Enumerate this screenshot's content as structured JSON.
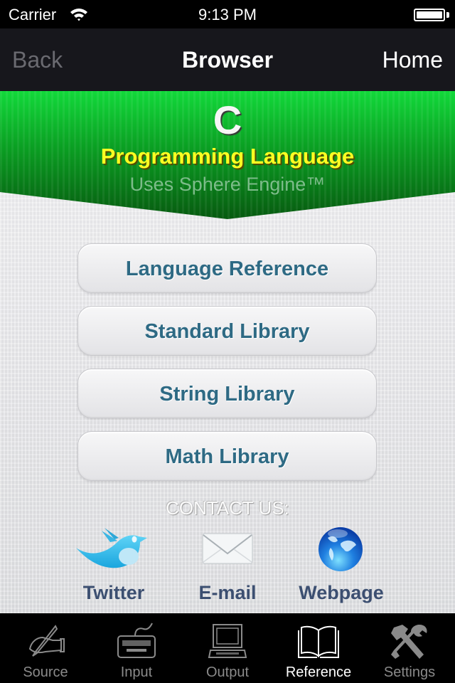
{
  "status_bar": {
    "carrier": "Carrier",
    "time": "9:13 PM",
    "wifi_icon": "wifi-icon",
    "battery_icon": "battery-icon"
  },
  "nav": {
    "back_label": "Back",
    "title": "Browser",
    "home_label": "Home"
  },
  "banner": {
    "title": "C",
    "subtitle": "Programming Language",
    "tagline": "Uses Sphere Engine™",
    "colors": {
      "green_top": "#12d93a",
      "green_bottom": "#0a5c12",
      "subtitle": "#ffff22"
    }
  },
  "menu": {
    "items": [
      {
        "label": "Language Reference"
      },
      {
        "label": "Standard Library"
      },
      {
        "label": "String Library"
      },
      {
        "label": "Math Library"
      }
    ],
    "text_color": "#2e6a84"
  },
  "contact": {
    "heading": "CONTACT US:",
    "items": [
      {
        "label": "Twitter",
        "icon": "twitter-bird-icon"
      },
      {
        "label": "E-mail",
        "icon": "envelope-icon"
      },
      {
        "label": "Webpage",
        "icon": "globe-icon"
      }
    ]
  },
  "tabs": {
    "items": [
      {
        "label": "Source",
        "icon": "hand-writing-icon",
        "active": false
      },
      {
        "label": "Input",
        "icon": "keyboard-icon",
        "active": false
      },
      {
        "label": "Output",
        "icon": "computer-icon",
        "active": false
      },
      {
        "label": "Reference",
        "icon": "open-book-icon",
        "active": true
      },
      {
        "label": "Settings",
        "icon": "tools-icon",
        "active": false
      }
    ]
  }
}
